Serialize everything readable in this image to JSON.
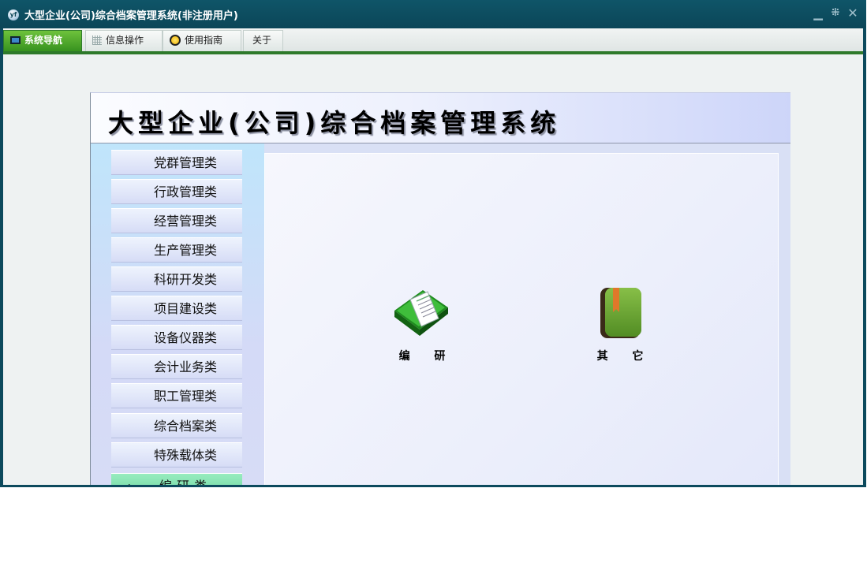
{
  "window": {
    "title": "大型企业(公司)综合档案管理系统(非注册用户)",
    "app_icon": "yf",
    "controls": [
      "minimize-icon",
      "restore-icon",
      "close-icon"
    ]
  },
  "menu": {
    "tabs": [
      {
        "label": "系统导航",
        "icon": "monitor-icon",
        "active": true
      },
      {
        "label": "信息操作",
        "icon": "grid-icon",
        "active": false
      },
      {
        "label": "使用指南",
        "icon": "help-icon",
        "active": false
      },
      {
        "label": "关于",
        "icon": "",
        "active": false
      }
    ]
  },
  "banner": {
    "title": "大型企业(公司)综合档案管理系统"
  },
  "sidebar": {
    "items": [
      {
        "label": "党群管理类"
      },
      {
        "label": "行政管理类"
      },
      {
        "label": "经营管理类"
      },
      {
        "label": "生产管理类"
      },
      {
        "label": "科研开发类"
      },
      {
        "label": "项目建设类"
      },
      {
        "label": "设备仪器类"
      },
      {
        "label": "会计业务类"
      },
      {
        "label": "职工管理类"
      },
      {
        "label": "综合档案类"
      },
      {
        "label": "特殊载体类"
      },
      {
        "label": "编研类",
        "active": true,
        "marker": "▸"
      }
    ]
  },
  "content": {
    "tiles": [
      {
        "label": "编 研",
        "icon": "green-book-icon"
      },
      {
        "label": "其 它",
        "icon": "bookmark-book-icon"
      }
    ]
  },
  "colors": {
    "titlebar": "#0c4a5d",
    "menu_active": "#4aa52a",
    "menu_underline": "#2e7a2b",
    "sidebar_active": "#7fe0ad"
  }
}
